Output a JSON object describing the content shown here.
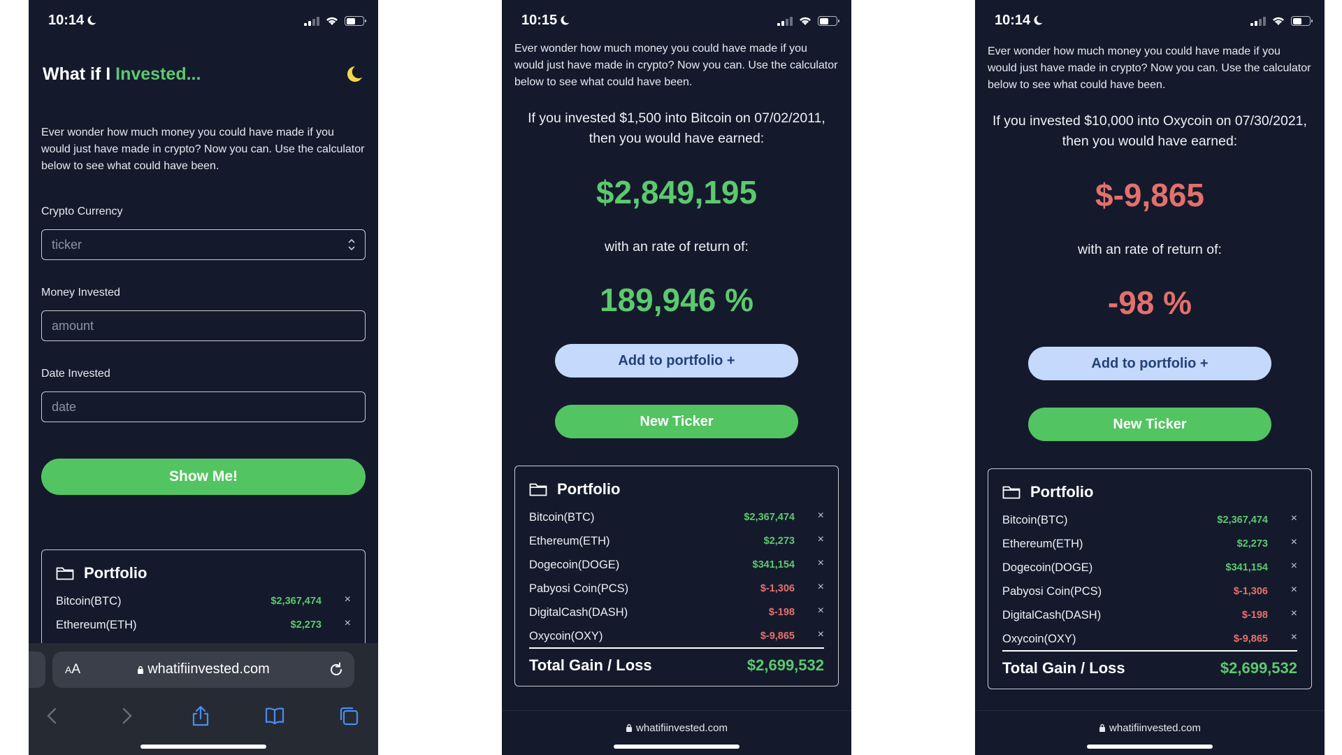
{
  "screen1": {
    "time": "10:14",
    "title_prefix": "What if I ",
    "title_accent": "Invested...",
    "intro": "Ever wonder how much money you could have made if you would just have made in crypto? Now you can. Use the calculator below to see what could have been.",
    "crypto_label": "Crypto Currency",
    "crypto_placeholder": "ticker",
    "money_label": "Money Invested",
    "money_placeholder": "amount",
    "date_label": "Date Invested",
    "date_placeholder": "date",
    "show_button": "Show Me!",
    "portfolio_title": "Portfolio",
    "portfolio_items": [
      {
        "name": "Bitcoin(BTC)",
        "value": "$2,367,474",
        "remove": "×"
      },
      {
        "name": "Ethereum(ETH)",
        "value": "$2,273",
        "remove": "×"
      }
    ],
    "safari": {
      "aa_label_big": "A",
      "aa_label_small": "A",
      "url": "whatifiinvested.com"
    }
  },
  "screen2": {
    "time": "10:15",
    "intro": "Ever wonder how much money you could have made if you would just have made in crypto? Now you can. Use the calculator below to see what could have been.",
    "sentence_line1": "If you invested $1,500 into Bitcoin on 07/02/2011,",
    "sentence_line2": "then you would have earned:",
    "amount": "$2,849,195",
    "rate_label": "with an rate of return of:",
    "rate": "189,946 %",
    "add_button": "Add to portfolio +",
    "new_ticker_button": "New Ticker",
    "portfolio_title": "Portfolio",
    "portfolio_items": [
      {
        "name": "Bitcoin(BTC)",
        "value": "$2,367,474",
        "remove": "×"
      },
      {
        "name": "Ethereum(ETH)",
        "value": "$2,273",
        "remove": "×"
      },
      {
        "name": "Dogecoin(DOGE)",
        "value": "$341,154",
        "remove": "×"
      },
      {
        "name": "Pabyosi Coin(PCS)",
        "value": "$-1,306",
        "remove": "×"
      },
      {
        "name": "DigitalCash(DASH)",
        "value": "$-198",
        "remove": "×"
      },
      {
        "name": "Oxycoin(OXY)",
        "value": "$-9,865",
        "remove": "×"
      }
    ],
    "total_label": "Total Gain / Loss",
    "total_value": "$2,699,532",
    "url": "whatifiinvested.com"
  },
  "screen3": {
    "time": "10:14",
    "intro": "Ever wonder how much money you could have made if you would just have made in crypto? Now you can. Use the calculator below to see what could have been.",
    "sentence_line1": "If you invested $10,000 into Oxycoin on 07/30/2021,",
    "sentence_line2": "then you would have earned:",
    "amount": "$-9,865",
    "rate_label": "with an rate of return of:",
    "rate": "-98 %",
    "add_button": "Add to portfolio +",
    "new_ticker_button": "New Ticker",
    "portfolio_title": "Portfolio",
    "portfolio_items": [
      {
        "name": "Bitcoin(BTC)",
        "value": "$2,367,474",
        "remove": "×"
      },
      {
        "name": "Ethereum(ETH)",
        "value": "$2,273",
        "remove": "×"
      },
      {
        "name": "Dogecoin(DOGE)",
        "value": "$341,154",
        "remove": "×"
      },
      {
        "name": "Pabyosi Coin(PCS)",
        "value": "$-1,306",
        "remove": "×"
      },
      {
        "name": "DigitalCash(DASH)",
        "value": "$-198",
        "remove": "×"
      },
      {
        "name": "Oxycoin(OXY)",
        "value": "$-9,865",
        "remove": "×"
      }
    ],
    "total_label": "Total Gain / Loss",
    "total_value": "$2,699,532",
    "url": "whatifiinvested.com"
  },
  "colors": {
    "background": "#141a2c",
    "accent_green": "#5cc96e",
    "negative_red": "#e4706d",
    "light_blue_button": "#c4d9fb"
  },
  "icons": [
    "moon-icon",
    "signal-icon",
    "wifi-icon",
    "battery-icon",
    "chevron-updown-icon",
    "folder-icon",
    "close-icon",
    "lock-icon",
    "reload-icon",
    "back-icon",
    "forward-icon",
    "share-icon",
    "bookmarks-icon",
    "tabs-icon"
  ]
}
